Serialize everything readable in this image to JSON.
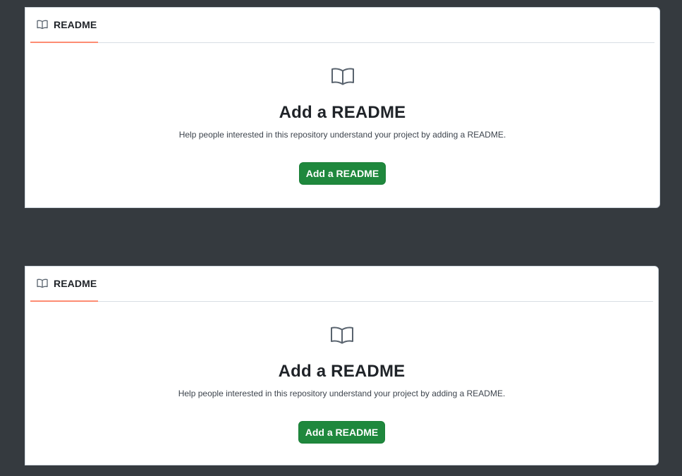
{
  "colors": {
    "background": "#353a3f",
    "panel": "#ffffff",
    "tab_underline": "#fd8c73",
    "primary_button": "#1f883d",
    "text": "#1f2328",
    "muted_text": "#3d444d"
  },
  "panels": [
    {
      "tab": {
        "label": "README",
        "icon": "book-icon"
      },
      "empty_state": {
        "icon": "book-icon",
        "title": "Add a README",
        "description": "Help people interested in this repository understand your project by adding a README.",
        "button_label": "Add a README"
      }
    },
    {
      "tab": {
        "label": "README",
        "icon": "book-icon"
      },
      "empty_state": {
        "icon": "book-icon",
        "title": "Add a README",
        "description": "Help people interested in this repository understand your project by adding a README.",
        "button_label": "Add a README"
      }
    }
  ]
}
